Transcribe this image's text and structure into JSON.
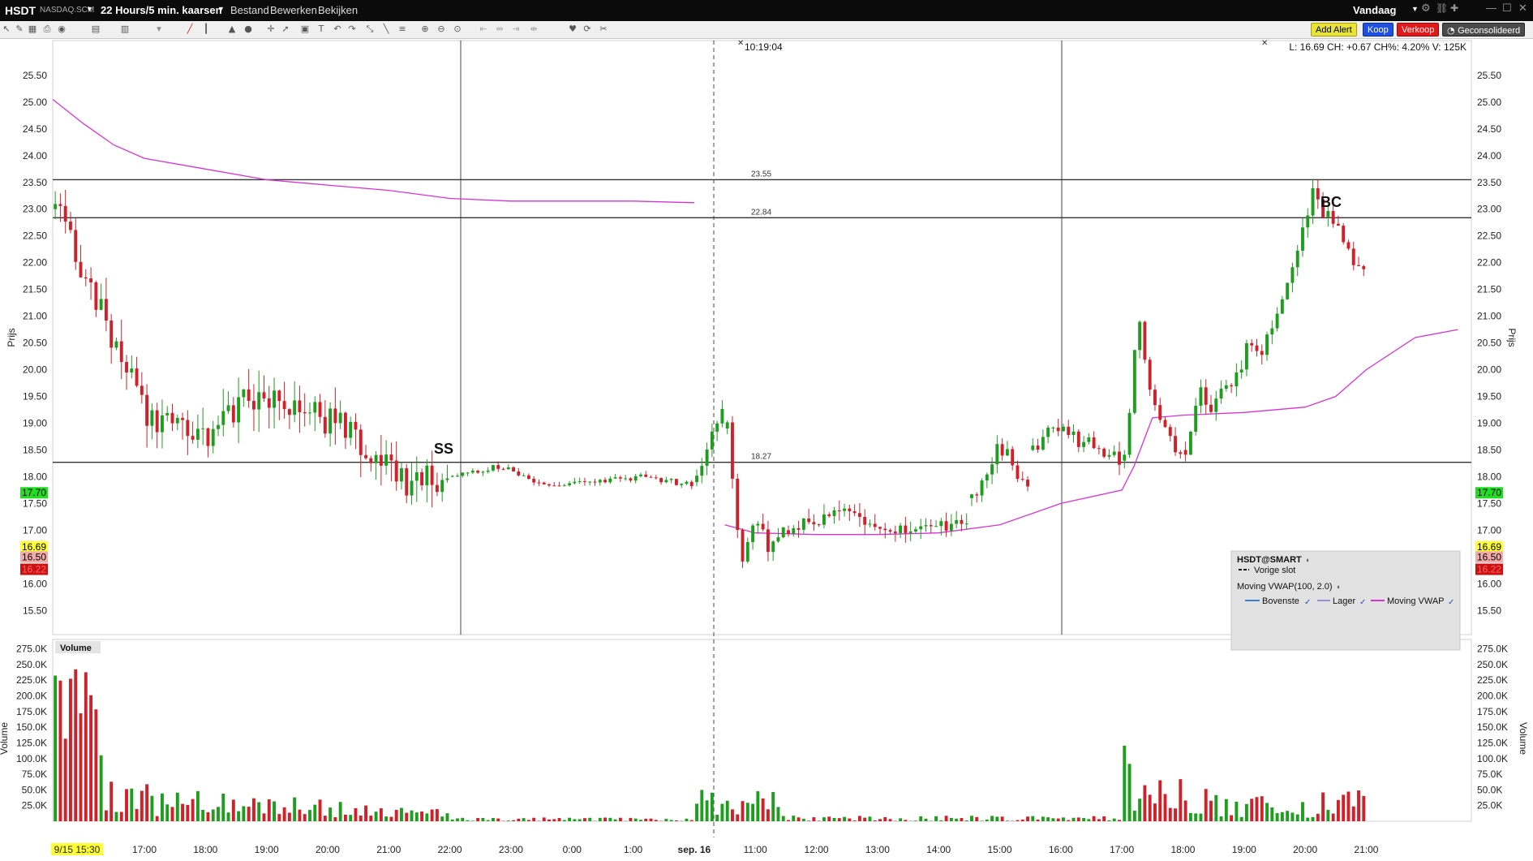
{
  "menubar": {
    "symbol": "HSDT",
    "exchange": "NASDAQ.SCM",
    "timeframe": "22 Hours/5 min. kaarsen",
    "menu_file": "Bestand",
    "menu_edit": "Bewerken",
    "menu_view": "Bekijken",
    "period": "Vandaag"
  },
  "toolbar": {
    "add_alert": "Add Alert",
    "buy": "Koop",
    "sell": "Verkoop",
    "consolidated": "Geconsolideerd"
  },
  "info": {
    "cursor_time": "10:19:04",
    "quote": "L: 16.69 CH: +0.67 CH%: 4.20% V: 125K"
  },
  "annotations": {
    "ss": "SS",
    "bc": "BC"
  },
  "legend": {
    "title": "HSDT@SMART",
    "prev_close": "Vorige slot",
    "study": "Moving VWAP(100, 2.0)",
    "upper": "Bovenste",
    "lower": "Lager",
    "vwap": "Moving VWAP"
  },
  "colors": {
    "up": "#1e9d1e",
    "down": "#d0202a",
    "vwap": "#d633d6",
    "hline": "#333333"
  },
  "chart_data": [
    {
      "type": "candlestick",
      "ylabel": "Prijs",
      "ylim": [
        15.05,
        26.15
      ],
      "yticks": [
        "25.50",
        "25.00",
        "24.50",
        "24.00",
        "23.50",
        "23.00",
        "22.50",
        "22.00",
        "21.50",
        "21.00",
        "20.50",
        "20.00",
        "19.50",
        "19.00",
        "18.50",
        "18.00",
        "17.50",
        "17.00",
        "16.50",
        "16.00",
        "15.50"
      ],
      "hlines": [
        23.55,
        22.84,
        18.27
      ],
      "price_tags": [
        {
          "value": "17.70",
          "price": 17.7,
          "color": "#22dd22"
        },
        {
          "value": "16.69",
          "price": 16.69,
          "color": "#ffff33"
        },
        {
          "value": "16.50",
          "price": 16.5,
          "color": "#f3aaaa"
        },
        {
          "value": "16.22",
          "price": 16.27,
          "color": "#cc1111"
        }
      ],
      "segments": [
        {
          "t0": 15.5,
          "t1": 22.0,
          "w": [
            [
              23.0,
              0
            ],
            [
              21.0,
              0.45
            ],
            [
              19.0,
              -0.15
            ],
            [
              18.6,
              0.3
            ],
            [
              19.5,
              0.5
            ],
            [
              19.3,
              -0.2
            ],
            [
              18.9,
              0.3
            ],
            [
              17.9,
              -0.3
            ],
            [
              18.0,
              0.2
            ]
          ]
        },
        {
          "t0": 22.0,
          "t1": 26.0,
          "w": [
            [
              18.0,
              0
            ],
            [
              18.2,
              0
            ],
            [
              17.8,
              0.1
            ],
            [
              17.9,
              -0.1
            ],
            [
              18.0,
              0.1
            ],
            [
              17.85,
              0
            ]
          ]
        },
        {
          "t0": 26.0,
          "t1": 26.5,
          "w": [
            [
              17.9,
              0
            ],
            [
              18.8,
              0.5
            ],
            [
              19.3,
              0
            ]
          ]
        },
        {
          "t0": 26.5,
          "t1": 27.5,
          "w": [
            [
              18.9,
              0
            ],
            [
              16.4,
              -0.2
            ],
            [
              17.2,
              0.1
            ],
            [
              16.6,
              0
            ],
            [
              17.0,
              0
            ]
          ]
        },
        {
          "t0": 27.5,
          "t1": 30.5,
          "w": [
            [
              17.0,
              0
            ],
            [
              17.3,
              0
            ],
            [
              17.0,
              0.1
            ],
            [
              17.15,
              0
            ]
          ]
        },
        {
          "t0": 30.5,
          "t1": 31.5,
          "w": [
            [
              17.6,
              0
            ],
            [
              18.6,
              0.2
            ],
            [
              17.8,
              0
            ]
          ]
        },
        {
          "t0": 31.5,
          "t1": 33.0,
          "w": [
            [
              18.5,
              0.3
            ],
            [
              19.0,
              0
            ],
            [
              18.7,
              -0.1
            ],
            [
              18.6,
              0.1
            ],
            [
              18.25,
              0
            ]
          ]
        },
        {
          "t0": 33.0,
          "t1": 34.0,
          "w": [
            [
              18.3,
              0
            ],
            [
              21.0,
              0.3
            ],
            [
              19.4,
              -0.2
            ],
            [
              18.9,
              0.2
            ],
            [
              18.4,
              0
            ]
          ]
        },
        {
          "t0": 34.0,
          "t1": 37.0,
          "w": [
            [
              18.5,
              0
            ],
            [
              19.6,
              0.2
            ],
            [
              19.3,
              0
            ],
            [
              19.6,
              0.1
            ],
            [
              19.9,
              0
            ],
            [
              20.5,
              0.2
            ],
            [
              20.3,
              0
            ],
            [
              21.0,
              0.2
            ],
            [
              21.6,
              0
            ],
            [
              22.5,
              0.3
            ],
            [
              23.3,
              0
            ],
            [
              22.9,
              -0.1
            ],
            [
              22.6,
              0.2
            ],
            [
              22.0,
              -0.2
            ],
            [
              21.9,
              0
            ]
          ]
        }
      ],
      "vwap_segments": [
        {
          "t0": 15.5,
          "t1": 26.0,
          "anchors": [
            [
              15.5,
              25.05
            ],
            [
              16.0,
              24.6
            ],
            [
              16.5,
              24.2
            ],
            [
              17.0,
              23.95
            ],
            [
              18.0,
              23.75
            ],
            [
              19.0,
              23.55
            ],
            [
              20.0,
              23.45
            ],
            [
              21.0,
              23.35
            ],
            [
              22.0,
              23.2
            ],
            [
              23.0,
              23.15
            ],
            [
              24.0,
              23.15
            ],
            [
              25.0,
              23.15
            ],
            [
              26.0,
              23.12
            ]
          ]
        },
        {
          "t0": 26.5,
          "t1": 37.0,
          "anchors": [
            [
              26.5,
              17.1
            ],
            [
              27.0,
              16.95
            ],
            [
              28.0,
              16.92
            ],
            [
              29.0,
              16.92
            ],
            [
              30.0,
              16.95
            ],
            [
              31.0,
              17.1
            ],
            [
              32.0,
              17.5
            ],
            [
              33.0,
              17.75
            ],
            [
              33.2,
              18.2
            ],
            [
              33.5,
              19.1
            ],
            [
              34.0,
              19.15
            ],
            [
              35.0,
              19.2
            ],
            [
              36.0,
              19.3
            ],
            [
              36.5,
              19.5
            ],
            [
              37.0,
              20.0
            ],
            [
              37.8,
              20.6
            ],
            [
              38.5,
              20.75
            ]
          ]
        }
      ]
    },
    {
      "type": "bar",
      "ylabel": "Volume",
      "legend": "Volume",
      "ylim": [
        0,
        290000
      ],
      "yticks": [
        "275.0K",
        "250.0K",
        "225.0K",
        "200.0K",
        "175.0K",
        "150.0K",
        "125.0K",
        "100.0K",
        "75.0K",
        "50.0K",
        "25.0K"
      ]
    },
    {
      "type": "time-axis",
      "ticks": [
        {
          "t": 15.5,
          "label": "9/15 15:30",
          "highlight": true
        },
        {
          "t": 17,
          "label": "17:00"
        },
        {
          "t": 18,
          "label": "18:00"
        },
        {
          "t": 19,
          "label": "19:00"
        },
        {
          "t": 20,
          "label": "20:00"
        },
        {
          "t": 21,
          "label": "21:00"
        },
        {
          "t": 22,
          "label": "22:00"
        },
        {
          "t": 23,
          "label": "23:00"
        },
        {
          "t": 24,
          "label": "0:00"
        },
        {
          "t": 25,
          "label": "1:00"
        },
        {
          "t": 26,
          "label": "sep. 16",
          "bold": true
        },
        {
          "t": 27,
          "label": "11:00"
        },
        {
          "t": 28,
          "label": "12:00"
        },
        {
          "t": 29,
          "label": "13:00"
        },
        {
          "t": 30,
          "label": "14:00"
        },
        {
          "t": 31,
          "label": "15:00"
        },
        {
          "t": 32,
          "label": "16:00"
        },
        {
          "t": 33,
          "label": "17:00"
        },
        {
          "t": 34,
          "label": "18:00"
        },
        {
          "t": 35,
          "label": "19:00"
        },
        {
          "t": 36,
          "label": "20:00"
        },
        {
          "t": 37,
          "label": "21:00"
        }
      ]
    }
  ]
}
